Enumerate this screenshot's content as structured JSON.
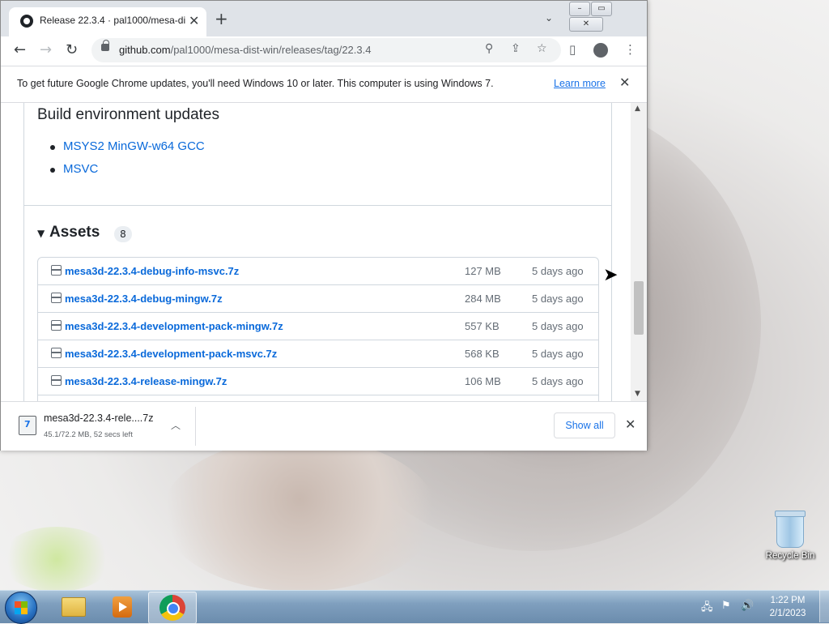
{
  "browser": {
    "tab_title": "Release 22.3.4 · pal1000/mesa-di",
    "url_host": "github.com",
    "url_path": "/pal1000/mesa-dist-win/releases/tag/22.3.4"
  },
  "infobar": {
    "message": "To get future Google Chrome updates, you'll need Windows 10 or later. This computer is using Windows 7.",
    "link": "Learn more"
  },
  "page": {
    "build_heading": "Build environment updates",
    "build_items": [
      "MSYS2 MinGW-w64 GCC",
      "MSVC"
    ],
    "assets_title": "Assets",
    "assets_count": "8",
    "assets": [
      {
        "name": "mesa3d-22.3.4-debug-info-msvc.7z",
        "size": "127 MB",
        "date": "5 days ago"
      },
      {
        "name": "mesa3d-22.3.4-debug-mingw.7z",
        "size": "284 MB",
        "date": "5 days ago"
      },
      {
        "name": "mesa3d-22.3.4-development-pack-mingw.7z",
        "size": "557 KB",
        "date": "5 days ago"
      },
      {
        "name": "mesa3d-22.3.4-development-pack-msvc.7z",
        "size": "568 KB",
        "date": "5 days ago"
      },
      {
        "name": "mesa3d-22.3.4-release-mingw.7z",
        "size": "106 MB",
        "date": "5 days ago"
      }
    ]
  },
  "download": {
    "filename": "mesa3d-22.3.4-rele....7z",
    "status": "45.1/72.2 MB, 52 secs left",
    "show_all": "Show all"
  },
  "desktop": {
    "recycle_bin": "Recycle Bin"
  },
  "taskbar": {
    "time": "1:22 PM",
    "date": "2/1/2023"
  }
}
